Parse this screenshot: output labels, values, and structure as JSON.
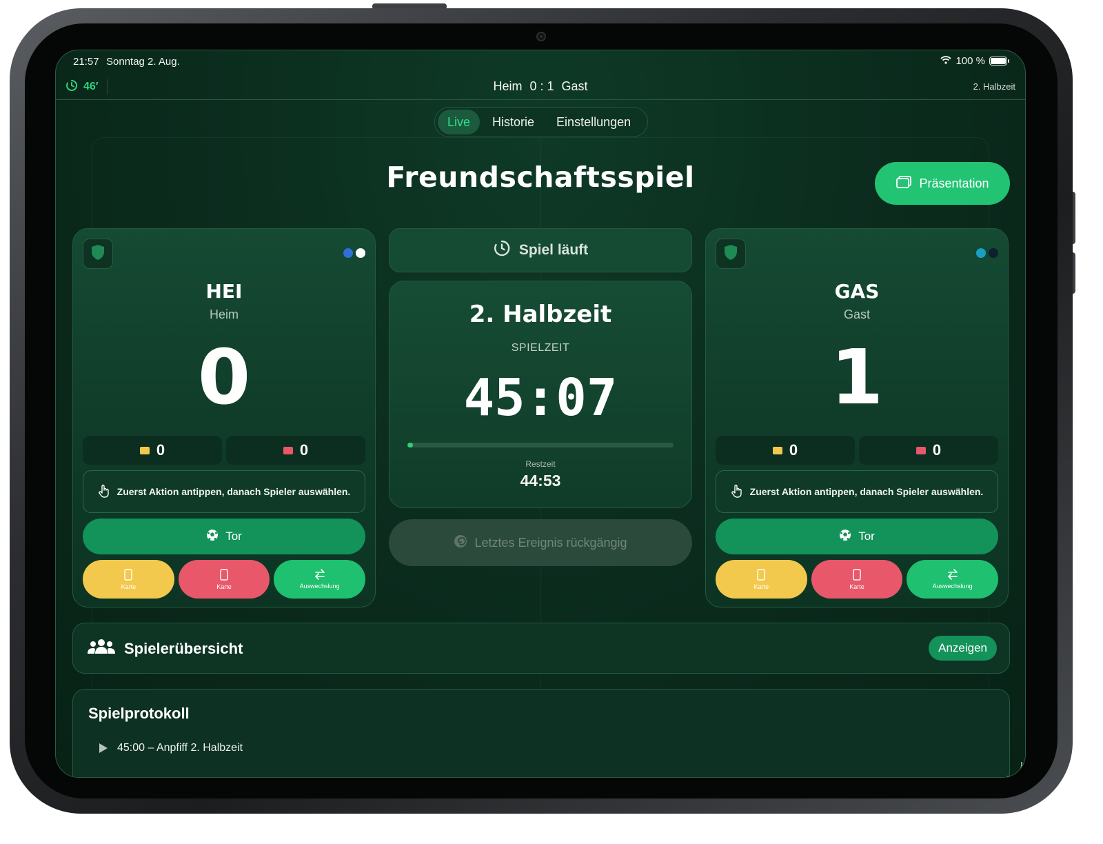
{
  "statusbar": {
    "time": "21:57",
    "date": "Sonntag 2. Aug.",
    "battery": "100 %"
  },
  "topbar": {
    "clock": "46′",
    "home": "Heim",
    "score": "0 : 1",
    "away": "Gast",
    "half": "2. Halbzeit"
  },
  "tabs": [
    {
      "label": "Live",
      "active": true
    },
    {
      "label": "Historie",
      "active": false
    },
    {
      "label": "Einstellungen",
      "active": false
    }
  ],
  "title": "Freundschaftsspiel",
  "presentation_button": "Präsentation",
  "home": {
    "abbr": "HEI",
    "name": "Heim",
    "score": "0",
    "yellow_cards": "0",
    "red_cards": "0",
    "colors": [
      "#2f6fd8",
      "#ffffff"
    ],
    "hint": "Zuerst Aktion antippen, danach Spieler auswählen.",
    "goal_label": "Tor",
    "actions": [
      "Karte",
      "Karte",
      "Auswechslung"
    ]
  },
  "away": {
    "abbr": "GAS",
    "name": "Gast",
    "score": "1",
    "yellow_cards": "0",
    "red_cards": "0",
    "colors": [
      "#1a9fc4",
      "#0e1f2e"
    ],
    "hint": "Zuerst Aktion antippen, danach Spieler auswählen.",
    "goal_label": "Tor",
    "actions": [
      "Karte",
      "Karte",
      "Auswechslung"
    ]
  },
  "game_status": "Spiel läuft",
  "timer": {
    "half": "2. Halbzeit",
    "label": "SPIELZEIT",
    "time": "45:07",
    "progress_percent": 2,
    "rest_label": "Restzeit",
    "rest_time": "44:53"
  },
  "undo_label": "Letztes Ereignis rückgängig",
  "player_overview": {
    "title": "Spielerübersicht",
    "button": "Anzeigen"
  },
  "match_log": {
    "title": "Spielprotokoll",
    "entries": [
      "45:00 – Anpfiff 2. Halbzeit"
    ]
  },
  "colors": {
    "accent": "#2fd27a",
    "yellow_card": "#f2c94c",
    "red_card": "#e9576a",
    "goal_button": "#13925a"
  }
}
